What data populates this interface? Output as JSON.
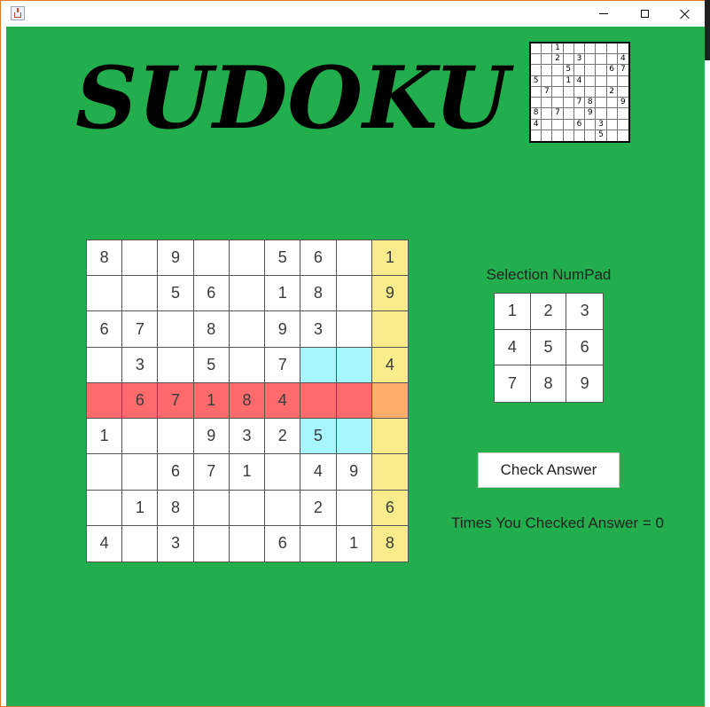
{
  "window": {
    "title": "",
    "icon": "java-cup-icon",
    "controls": [
      "minimize-icon",
      "maximize-icon",
      "close-icon"
    ],
    "frame_color": "#e07b2c"
  },
  "header": {
    "logo_text": "SUDOKU"
  },
  "thumbnail": {
    "cells": [
      "",
      "",
      "1",
      "",
      "",
      "",
      "",
      "",
      "",
      "",
      "",
      "2",
      "",
      "3",
      "",
      "",
      "",
      "4",
      "",
      "",
      "",
      "5",
      "",
      "",
      "",
      "6",
      "7",
      "5",
      "",
      "",
      "1",
      "4",
      "",
      "",
      "",
      "",
      "",
      "7",
      "",
      "",
      "",
      "",
      "",
      "2",
      "",
      "",
      "",
      "",
      "",
      "7",
      "8",
      "",
      "",
      "9",
      "8",
      "",
      "7",
      "",
      "",
      "9",
      "",
      "",
      "",
      "4",
      "",
      "",
      "",
      "6",
      "",
      "3",
      "",
      "",
      "",
      "",
      "",
      "",
      "",
      "",
      "5",
      "",
      ""
    ]
  },
  "board": {
    "cells": [
      "8",
      "",
      "9",
      "",
      "",
      "5",
      "6",
      "",
      "1",
      "",
      "",
      "5",
      "6",
      "",
      "1",
      "8",
      "",
      "9",
      "6",
      "7",
      "",
      "8",
      "",
      "9",
      "3",
      "",
      "",
      "",
      "3",
      "",
      "5",
      "",
      "7",
      "",
      "",
      "4",
      "",
      "6",
      "7",
      "1",
      "8",
      "4",
      "",
      "",
      "",
      "1",
      "",
      "",
      "9",
      "3",
      "2",
      "5",
      "",
      "",
      "",
      "",
      "6",
      "7",
      "1",
      "",
      "4",
      "9",
      "",
      "",
      "1",
      "8",
      "",
      "",
      "",
      "2",
      "",
      "6",
      "4",
      "",
      "3",
      "",
      "",
      "6",
      "",
      "1",
      "8"
    ],
    "highlight": {
      "row_color": "#ff6b6b",
      "column_color": "#f9ec8c",
      "intersection_color": "#fdae6a",
      "box_color": "#a7f5ff"
    }
  },
  "numpad": {
    "label": "Selection NumPad",
    "keys": [
      "1",
      "2",
      "3",
      "4",
      "5",
      "6",
      "7",
      "8",
      "9"
    ]
  },
  "check_button": {
    "label": "Check Answer"
  },
  "status": {
    "text": "Times You Checked Answer = 0"
  },
  "colors": {
    "background": "#22ae4c"
  }
}
